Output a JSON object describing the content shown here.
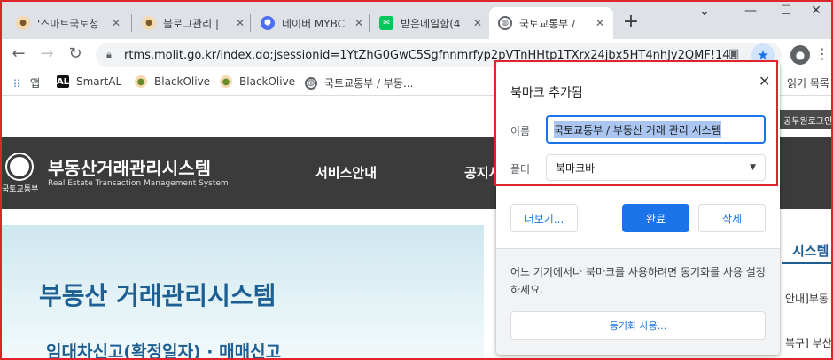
{
  "browser": {
    "tabs": [
      {
        "label": "'스마트국토청",
        "favicon_color": "#f5d9b0",
        "active": false
      },
      {
        "label": "블로그관리 |",
        "favicon_color": "#f5d9b0",
        "active": false
      },
      {
        "label": "네이버 MYBC",
        "favicon_color": "#4c6ef5",
        "active": false
      },
      {
        "label": "받은메일함(4",
        "favicon_color": "#03c75a",
        "active": false
      },
      {
        "label": "국토교통부 /",
        "favicon_color": "#5f6368",
        "active": true
      }
    ],
    "new_tab_symbol": "+",
    "window_controls": {
      "minimize": "—",
      "maximize": "☐",
      "close": "✕",
      "dropdown": "⌄"
    },
    "url": "rtms.molit.go.kr/index.do;jsessionid=1YtZhG0GwC5Sgfnnmrfyp2pVTnHHtp1TXrx24jbx5HT4nhJy2QMF!14...",
    "bookmarks": [
      {
        "label": "앱",
        "icon": "apps-grid-icon"
      },
      {
        "label": "SmartAL",
        "icon": "smartal-icon"
      },
      {
        "label": "BlackOlive",
        "icon": "blackolive-icon"
      },
      {
        "label": "BlackOlive",
        "icon": "blackolive-icon"
      },
      {
        "label": "국토교통부 / 부동...",
        "icon": "globe-icon"
      }
    ],
    "bookmarks_overflow": "읽기 목록"
  },
  "site": {
    "login_btn": "공무원로그인",
    "logo_sub": "국토교통부",
    "title": "부동산거래관리시스템",
    "subtitle": "Real Estate Transaction Management System",
    "nav": [
      "서비스안내",
      "공지사"
    ],
    "hero_title": "부동산 거래관리시스템",
    "hero_sub": "임대차신고(확정일자) · 매매신고",
    "right_title": "시스템",
    "right_items": [
      "안내]부동",
      "복구] 부산"
    ]
  },
  "bookmark_bubble": {
    "title": "북마크 추가됨",
    "name_label": "이름",
    "name_value": "국토교통부 / 부동산 거래 관리 시스템",
    "folder_label": "폴더",
    "folder_value": "북마크바",
    "more_btn": "더보기...",
    "done_btn": "완료",
    "remove_btn": "삭제",
    "sync_text": "어느 기기에서나 북마크를 사용하려면 동기화를 사용 설정하세요.",
    "sync_btn": "동기화 사용..."
  },
  "colors": {
    "accent": "#1a73e8",
    "highlight_border": "#e0242b",
    "site_header": "#3b3b3b",
    "hero_text": "#1d5f93"
  }
}
